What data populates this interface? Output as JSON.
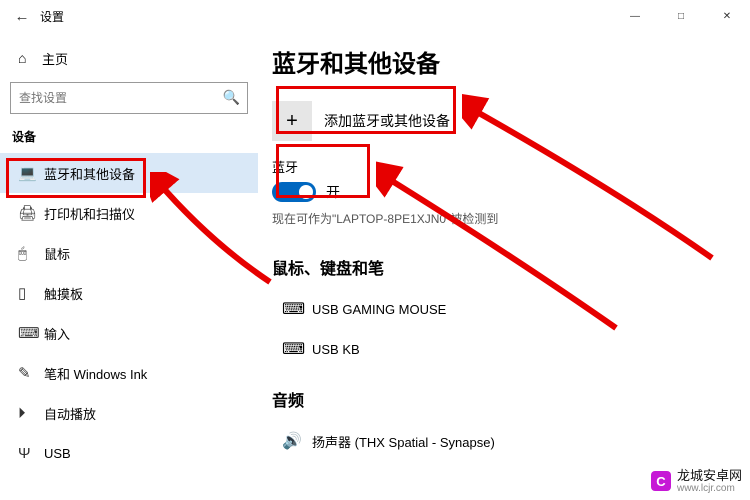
{
  "titlebar": {
    "title": "设置"
  },
  "sidebar": {
    "home": "主页",
    "search_placeholder": "查找设置",
    "section": "设备",
    "items": [
      {
        "label": "蓝牙和其他设备"
      },
      {
        "label": "打印机和扫描仪"
      },
      {
        "label": "鼠标"
      },
      {
        "label": "触摸板"
      },
      {
        "label": "输入"
      },
      {
        "label": "笔和 Windows Ink"
      },
      {
        "label": "自动播放"
      },
      {
        "label": "USB"
      }
    ]
  },
  "content": {
    "heading": "蓝牙和其他设备",
    "add_label": "添加蓝牙或其他设备",
    "bt_section": "蓝牙",
    "bt_state": "开",
    "discoverable": "现在可作为\"LAPTOP-8PE1XJN0\"被检测到",
    "mkp_heading": "鼠标、键盘和笔",
    "devices": [
      {
        "name": "USB GAMING MOUSE"
      },
      {
        "name": "USB KB"
      }
    ],
    "audio_heading": "音频",
    "audio_devices": [
      {
        "name": "扬声器 (THX Spatial - Synapse)"
      }
    ]
  },
  "watermark": {
    "line1": "龙城安卓网",
    "line2": "www.lcjr.com"
  }
}
